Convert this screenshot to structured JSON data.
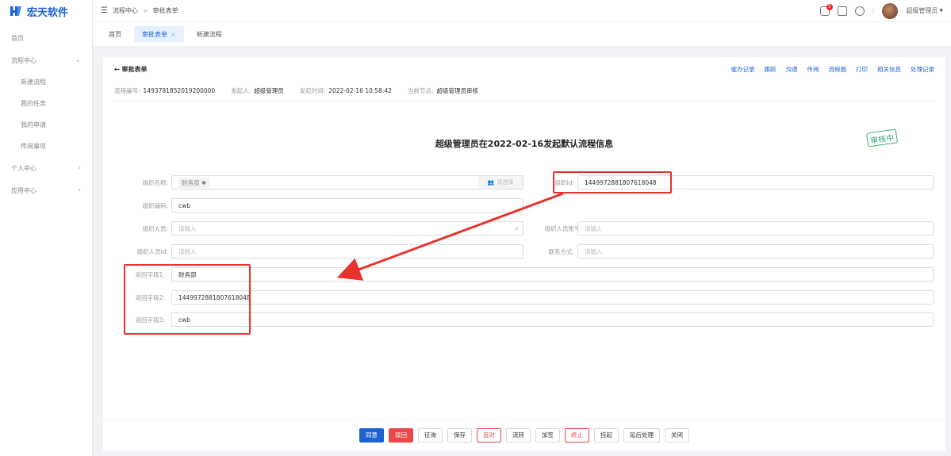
{
  "app": {
    "logo_text": "宏天软件"
  },
  "sidebar": {
    "home": "首页",
    "process_center": "流程中心",
    "sub_items": [
      "新建流程",
      "我的任务",
      "我的申请",
      "传阅事项"
    ],
    "personal_center": "个人中心",
    "app_center": "应用中心"
  },
  "header": {
    "breadcrumb": [
      "流程中心",
      "审批表单"
    ],
    "breadcrumb_sep": ">",
    "notification_count": "5",
    "user_name": "超级管理员",
    "sep": "|"
  },
  "tabs": [
    {
      "label": "首页"
    },
    {
      "label": "审批表单",
      "active": true,
      "close": "×"
    },
    {
      "label": "新建流程"
    }
  ],
  "page": {
    "back_title": "← 审批表单",
    "actions": [
      "催办记录",
      "跟踪",
      "沟通",
      "传阅",
      "流程图",
      "打印",
      "相关信息",
      "处理记录"
    ],
    "meta": {
      "flow_no_label": "流程编号:",
      "flow_no": "1493781852019200000",
      "initiator_label": "发起人:",
      "initiator": "超级管理员",
      "time_label": "发起时间:",
      "time": "2022-02-16 10:58:42",
      "node_label": "当前节点:",
      "node": "超级管理员审核"
    },
    "form_title": "超级管理员在2022-02-16发起默认流程信息",
    "stamp": "审核中"
  },
  "form": {
    "org_name_label": "组织名称:",
    "org_name_chip": "财务部",
    "select_btn": "请选择",
    "org_id_label": "组织id:",
    "org_id": "1449972881807618048",
    "org_code_label": "组织编码:",
    "org_code": "cwb",
    "org_person_label": "组织人员:",
    "org_person_ph": "请输入",
    "org_person_acct_label": "组织人员账号:",
    "org_person_acct_ph": "请输入",
    "org_person_id_label": "组织人员id:",
    "org_person_id_ph": "请输入",
    "contact_label": "联系方式:",
    "contact_ph": "请输入",
    "ret1_label": "返回字段1:",
    "ret1": "财务部",
    "ret2_label": "返回字段2:",
    "ret2": "1449972881807618048",
    "ret3_label": "返回字段3:",
    "ret3": "cwb"
  },
  "footer_buttons": [
    "同意",
    "驳回",
    "征询",
    "保存",
    "反对",
    "流转",
    "加签",
    "终止",
    "挂起",
    "延后处理",
    "关闭"
  ],
  "colors": {
    "accent": "#1e62d0",
    "danger": "#e8322e",
    "stamp": "#3aa96b"
  }
}
